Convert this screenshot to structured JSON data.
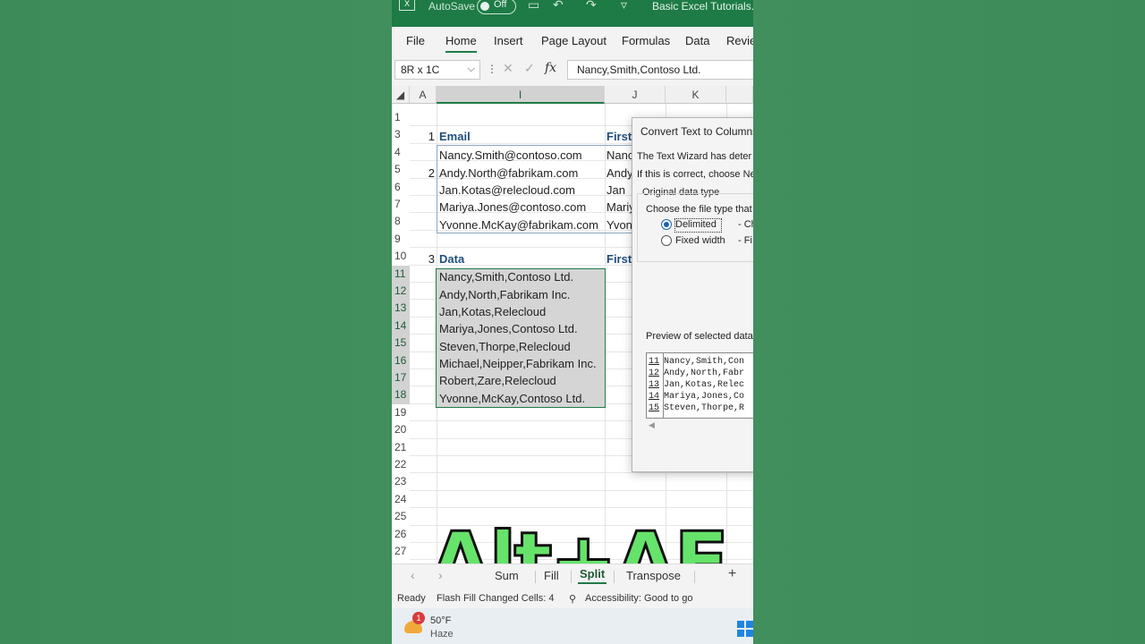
{
  "window": {
    "autosave_label": "AutoSave",
    "autosave_state": "Off",
    "file_name": "Basic Excel Tutorials.xlsx"
  },
  "ribbon": {
    "tabs": [
      "File",
      "Home",
      "Insert",
      "Page Layout",
      "Formulas",
      "Data",
      "Review"
    ],
    "active_tab": "Home"
  },
  "formula_bar": {
    "name_box": "8R x 1C",
    "fx": "fx",
    "formula": "Nancy,Smith,Contoso Ltd."
  },
  "columns": [
    "A",
    "I",
    "J",
    "K"
  ],
  "selected_column": "I",
  "rows": [
    "1",
    "3",
    "4",
    "5",
    "6",
    "7",
    "8",
    "9",
    "10",
    "11",
    "12",
    "13",
    "14",
    "15",
    "16",
    "17",
    "18",
    "19",
    "20",
    "21",
    "22",
    "23",
    "24",
    "25",
    "26",
    "27"
  ],
  "sheet": {
    "section1": {
      "num": "1",
      "header": "Email",
      "next_header": "First"
    },
    "emails": [
      "Nancy.Smith@contoso.com",
      "Andy.North@fabrikam.com",
      "Jan.Kotas@relecloud.com",
      "Mariya.Jones@contoso.com",
      "Yvonne.McKay@fabrikam.com"
    ],
    "first_names": [
      "Nanc",
      "Andy",
      "Jan",
      "Mariy",
      "Yvon"
    ],
    "section2_num": "2",
    "section3": {
      "num": "3",
      "header": "Data",
      "next_header": "First"
    },
    "data": [
      "Nancy,Smith,Contoso Ltd.",
      "Andy,North,Fabrikam Inc.",
      "Jan,Kotas,Relecloud",
      "Mariya,Jones,Contoso Ltd.",
      "Steven,Thorpe,Relecloud",
      "Michael,Neipper,Fabrikam Inc.",
      "Robert,Zare,Relecloud",
      "Yvonne,McKay,Contoso Ltd."
    ]
  },
  "dialog": {
    "title": "Convert Text to Columns",
    "line1": "The Text Wizard has deter",
    "line2": "If this is correct, choose Ne",
    "group_label": "Original data type",
    "choose_label": "Choose the file type that",
    "option1": "Delimited",
    "option1_desc": "- Ch",
    "option2": "Fixed width",
    "option2_desc": "- Fi",
    "preview_label": "Preview of selected data",
    "preview_nums": [
      "11",
      "12",
      "13",
      "14",
      "15"
    ],
    "preview_rows": [
      "Nancy,Smith,Con",
      "Andy,North,Fabr",
      "Jan,Kotas,Relec",
      "Mariya,Jones,Co",
      "Steven,Thorpe,R"
    ]
  },
  "sheet_tabs": [
    "Sum",
    "Fill",
    "Split",
    "Transpose"
  ],
  "active_sheet": "Split",
  "status": {
    "ready": "Ready",
    "flash_fill": "Flash Fill Changed Cells: 4",
    "accessibility": "Accessibility: Good to go"
  },
  "taskbar": {
    "badge": "1",
    "temperature": "50°F",
    "condition": "Haze"
  },
  "overlay_text": "Alt+AE",
  "colors": {
    "excel_green": "#1e7b45",
    "overlay_green": "#66e36a",
    "header_blue": "#1f4f7a"
  }
}
